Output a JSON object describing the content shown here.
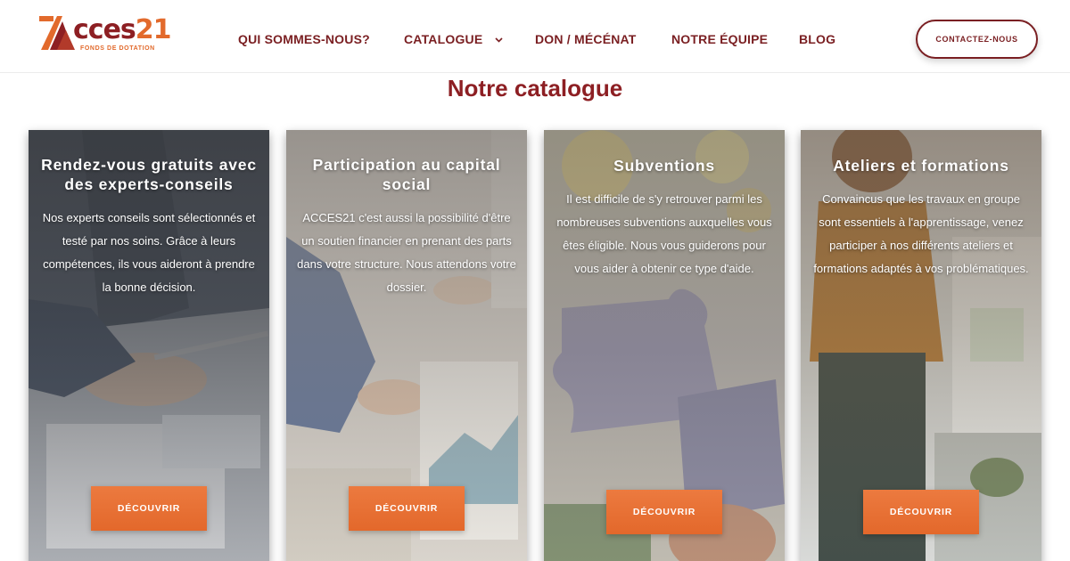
{
  "logo": {
    "text_prefix": "cces",
    "text_num": "21",
    "subtitle": "FONDS DE DOTATION"
  },
  "nav": {
    "items": [
      {
        "label": "QUI SOMMES-NOUS?"
      },
      {
        "label": "CATALOGUE"
      },
      {
        "label": "DON / MÉCÉNAT"
      },
      {
        "label": "NOTRE ÉQUIPE"
      },
      {
        "label": "BLOG"
      }
    ],
    "contact_label": "CONTACTEZ-NOUS"
  },
  "section": {
    "title": "Notre catalogue"
  },
  "cards": [
    {
      "title": "Rendez-vous gratuits avec des experts-conseils",
      "text": "Nos experts conseils sont sélectionnés et testé par nos soins. Grâce à leurs compétences, ils vous aideront à prendre la bonne décision.",
      "button": "DÉCOUVRIR"
    },
    {
      "title": "Participation au capital social",
      "text": "ACCES21 c'est aussi la possibilité d'être un soutien financier en prenant des parts dans votre structure. Nous attendons votre dossier.",
      "button": "DÉCOUVRIR"
    },
    {
      "title": "Subventions",
      "text": "Il est difficile de s'y retrouver parmi les nombreuses subventions auxquelles vous êtes éligible. Nous vous guiderons pour vous aider à obtenir ce type d'aide.",
      "button": "DÉCOUVRIR"
    },
    {
      "title": "Ateliers et formations",
      "text": "Convaincus que les travaux en groupe sont essentiels à l'apprentissage, venez participer à nos différents ateliers et formations adaptés à vos problématiques.",
      "button": "DÉCOUVRIR"
    }
  ],
  "colors": {
    "brand": "#8d1f23",
    "accent": "#e3682b"
  },
  "icons": {
    "chevron": "chevron-down-icon"
  }
}
